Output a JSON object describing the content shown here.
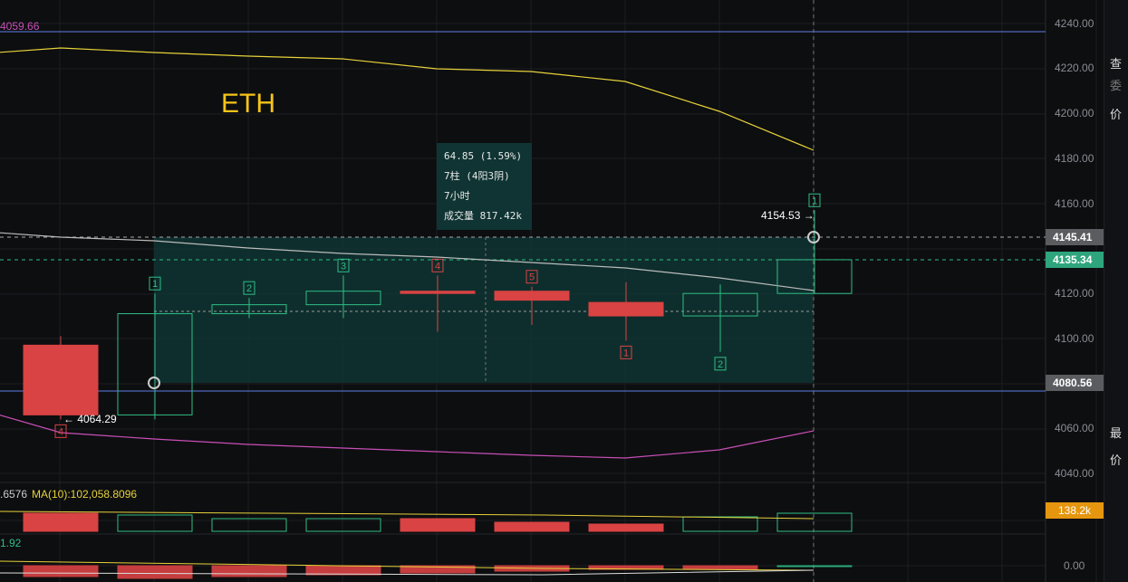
{
  "symbol": "ETH",
  "top_left_price": "4059.66",
  "y_axis": [
    "4240.00",
    "4220.00",
    "4200.00",
    "4180.00",
    "4160.00",
    "4120.00",
    "4100.00",
    "4060.00",
    "4040.00"
  ],
  "tags": {
    "high_line": "4145.41",
    "last_price": "4135.34",
    "low_line": "4080.56",
    "volume": "138.2k",
    "macd_zero": "0.00"
  },
  "annotations": {
    "high": "4154.53 →",
    "low": "← 4064.29"
  },
  "measure": {
    "change": "64.85 (1.59%)",
    "bars": "7柱 (4阳3阴)",
    "duration": "7小时",
    "volume": "成交量 817.42k"
  },
  "volume_panel": {
    "ma5": ".6576",
    "ma10": "MA(10):102,058.8096"
  },
  "macd_panel": {
    "value": "1.92"
  },
  "candles": [
    {
      "o": 4097,
      "h": 4101,
      "l": 4064,
      "c": 4066,
      "n": "4"
    },
    {
      "o": 4066,
      "h": 4120,
      "l": 4064,
      "c": 4111,
      "n": "1"
    },
    {
      "o": 4111,
      "h": 4118,
      "l": 4109,
      "c": 4115,
      "n": "2"
    },
    {
      "o": 4115,
      "h": 4128,
      "l": 4109,
      "c": 4121,
      "n": "3"
    },
    {
      "o": 4121,
      "h": 4128,
      "l": 4103,
      "c": 4120,
      "n": "4"
    },
    {
      "o": 4121,
      "h": 4123,
      "l": 4106,
      "c": 4117,
      "n": "5"
    },
    {
      "o": 4116,
      "h": 4125,
      "l": 4099,
      "c": 4110,
      "n": "1"
    },
    {
      "o": 4110,
      "h": 4124,
      "l": 4094,
      "c": 4120,
      "n": "2"
    },
    {
      "o": 4120,
      "h": 4157,
      "l": 4120,
      "c": 4135,
      "n": "1"
    }
  ],
  "colors": {
    "up": "#2ebd85",
    "down": "#d94343",
    "band_upper": "#e6d23a",
    "band_lower": "#c84fb6",
    "level": "#5f7fe6"
  },
  "side_panel": [
    "查",
    "委",
    "价",
    "最",
    "价"
  ]
}
